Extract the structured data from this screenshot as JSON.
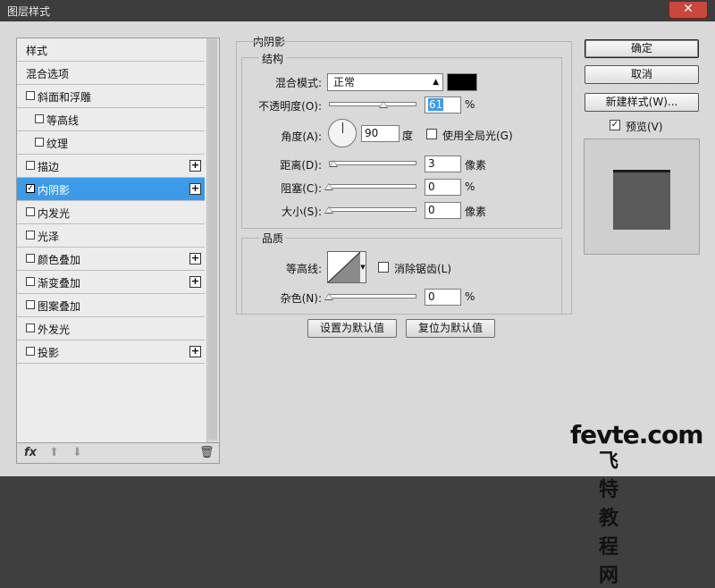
{
  "window": {
    "title": "图层样式",
    "close": "✕"
  },
  "sidebar": {
    "items": [
      {
        "label": "样式",
        "cb": false,
        "checked": false,
        "plus": false,
        "indent": false,
        "sel": false
      },
      {
        "label": "混合选项",
        "cb": false,
        "checked": false,
        "plus": false,
        "indent": false,
        "sel": false
      },
      {
        "label": "斜面和浮雕",
        "cb": true,
        "checked": false,
        "plus": false,
        "indent": false,
        "sel": false
      },
      {
        "label": "等高线",
        "cb": true,
        "checked": false,
        "plus": false,
        "indent": true,
        "sel": false
      },
      {
        "label": "纹理",
        "cb": true,
        "checked": false,
        "plus": false,
        "indent": true,
        "sel": false
      },
      {
        "label": "描边",
        "cb": true,
        "checked": false,
        "plus": true,
        "indent": false,
        "sel": false
      },
      {
        "label": "内阴影",
        "cb": true,
        "checked": true,
        "plus": true,
        "indent": false,
        "sel": true
      },
      {
        "label": "内发光",
        "cb": true,
        "checked": false,
        "plus": false,
        "indent": false,
        "sel": false
      },
      {
        "label": "光泽",
        "cb": true,
        "checked": false,
        "plus": false,
        "indent": false,
        "sel": false
      },
      {
        "label": "颜色叠加",
        "cb": true,
        "checked": false,
        "plus": true,
        "indent": false,
        "sel": false
      },
      {
        "label": "渐变叠加",
        "cb": true,
        "checked": false,
        "plus": true,
        "indent": false,
        "sel": false
      },
      {
        "label": "图案叠加",
        "cb": true,
        "checked": false,
        "plus": false,
        "indent": false,
        "sel": false
      },
      {
        "label": "外发光",
        "cb": true,
        "checked": false,
        "plus": false,
        "indent": false,
        "sel": false
      },
      {
        "label": "投影",
        "cb": true,
        "checked": false,
        "plus": true,
        "indent": false,
        "sel": false
      }
    ],
    "bottom": {
      "fx": "fx",
      "up": "⬆",
      "down": "⬇",
      "trash": "🗑"
    },
    "plus_glyph": "+",
    "check_glyph": "✓"
  },
  "inner_shadow": {
    "section_title": "内阴影",
    "structure": {
      "title": "结构",
      "blend_mode_label": "混合模式:",
      "blend_mode_value": "正常",
      "blend_color": "#000000",
      "opacity_label": "不透明度(O):",
      "opacity_value": "61",
      "opacity_unit": "%",
      "angle_label": "角度(A):",
      "angle_value": "90",
      "angle_unit": "度",
      "global_light_label": "使用全局光(G)",
      "distance_label": "距离(D):",
      "distance_value": "3",
      "distance_unit": "像素",
      "choke_label": "阻塞(C):",
      "choke_value": "0",
      "choke_unit": "%",
      "size_label": "大小(S):",
      "size_value": "0",
      "size_unit": "像素"
    },
    "quality": {
      "title": "品质",
      "contour_label": "等高线:",
      "anti_alias_label": "消除锯齿(L)",
      "noise_label": "杂色(N):",
      "noise_value": "0",
      "noise_unit": "%"
    },
    "buttons": {
      "make_default": "设置为默认值",
      "reset_default": "复位为默认值"
    }
  },
  "actions": {
    "ok": "确定",
    "cancel": "取消",
    "new_style": "新建样式(W)...",
    "preview_label": "预览(V)",
    "preview_checked": true
  },
  "watermark": {
    "line1": "fevte.com",
    "line2": "飞特教程网"
  },
  "colors": {
    "selection": "#3d9ae8",
    "titlebar": "#3d3d3d",
    "close": "#c9473d"
  }
}
